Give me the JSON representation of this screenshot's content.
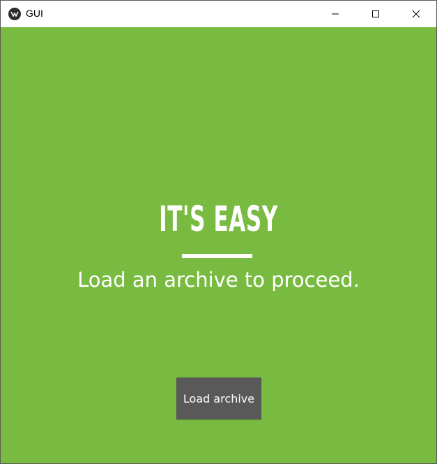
{
  "window": {
    "title": "GUI",
    "app_icon": "kivy-logo-icon",
    "controls": {
      "minimize_icon": "minimize-icon",
      "maximize_icon": "maximize-icon",
      "close_icon": "close-icon"
    }
  },
  "main": {
    "headline": "IT'S EASY",
    "subtitle": "Load an archive to proceed.",
    "load_button_label": "Load archive"
  },
  "colors": {
    "background": "#79bb41",
    "button": "#595959",
    "text": "#ffffff"
  }
}
